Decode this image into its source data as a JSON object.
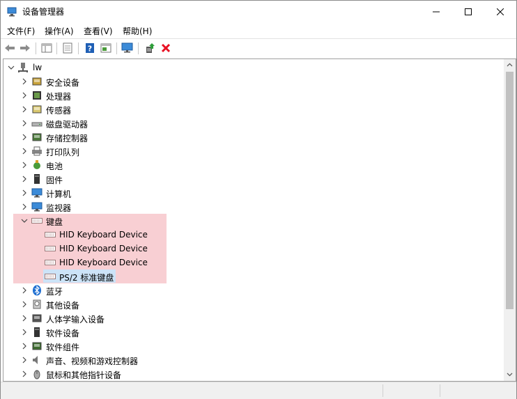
{
  "window": {
    "title": "设备管理器"
  },
  "menu": [
    "文件(F)",
    "操作(A)",
    "查看(V)",
    "帮助(H)"
  ],
  "tree": {
    "root": "lw",
    "items": [
      {
        "label": "安全设备",
        "icon": "security-device-icon"
      },
      {
        "label": "处理器",
        "icon": "processor-icon"
      },
      {
        "label": "传感器",
        "icon": "sensor-icon"
      },
      {
        "label": "磁盘驱动器",
        "icon": "disk-drive-icon"
      },
      {
        "label": "存储控制器",
        "icon": "storage-controller-icon"
      },
      {
        "label": "打印队列",
        "icon": "printer-icon"
      },
      {
        "label": "电池",
        "icon": "battery-icon"
      },
      {
        "label": "固件",
        "icon": "firmware-icon"
      },
      {
        "label": "计算机",
        "icon": "computer-icon"
      },
      {
        "label": "监视器",
        "icon": "monitor-icon"
      },
      {
        "label": "键盘",
        "icon": "keyboard-icon",
        "expanded": true
      },
      {
        "label": "蓝牙",
        "icon": "bluetooth-icon"
      },
      {
        "label": "其他设备",
        "icon": "other-devices-icon"
      },
      {
        "label": "人体学输入设备",
        "icon": "hid-icon"
      },
      {
        "label": "软件设备",
        "icon": "software-device-icon"
      },
      {
        "label": "软件组件",
        "icon": "software-component-icon"
      },
      {
        "label": "声音、视频和游戏控制器",
        "icon": "audio-icon"
      },
      {
        "label": "鼠标和其他指针设备",
        "icon": "mouse-icon"
      }
    ],
    "keyboard_children": [
      "HID Keyboard Device",
      "HID Keyboard Device",
      "HID Keyboard Device",
      "PS/2 标准键盘"
    ]
  },
  "colors": {
    "highlight": "#f8cfd3",
    "selection": "#cce3f7",
    "remove": "#e81123"
  }
}
